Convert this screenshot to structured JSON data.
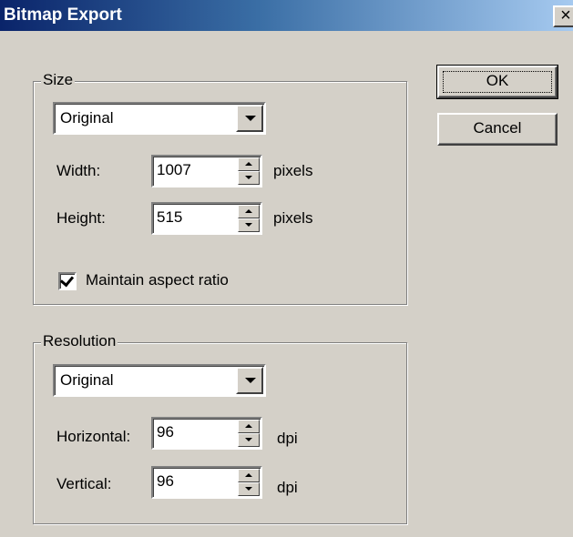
{
  "window": {
    "title": "Bitmap Export",
    "close_glyph": "×"
  },
  "size_group": {
    "legend": "Size",
    "preset": "Original",
    "width_label": "Width:",
    "width_value": "1007",
    "width_unit": "pixels",
    "height_label": "Height:",
    "height_value": "515",
    "height_unit": "pixels",
    "aspect_label": "Maintain aspect ratio",
    "aspect_checked": true
  },
  "resolution_group": {
    "legend": "Resolution",
    "preset": "Original",
    "horizontal_label": "Horizontal:",
    "horizontal_value": "96",
    "horizontal_unit": "dpi",
    "vertical_label": "Vertical:",
    "vertical_value": "96",
    "vertical_unit": "dpi"
  },
  "buttons": {
    "ok": "OK",
    "cancel": "Cancel"
  },
  "colors": {
    "titlebar_start": "#0a246a",
    "titlebar_end": "#a6caf0",
    "face": "#d4d0c8"
  },
  "icons": {
    "close": "close-icon",
    "dropdown": "chevron-down-icon",
    "check": "check-icon"
  }
}
